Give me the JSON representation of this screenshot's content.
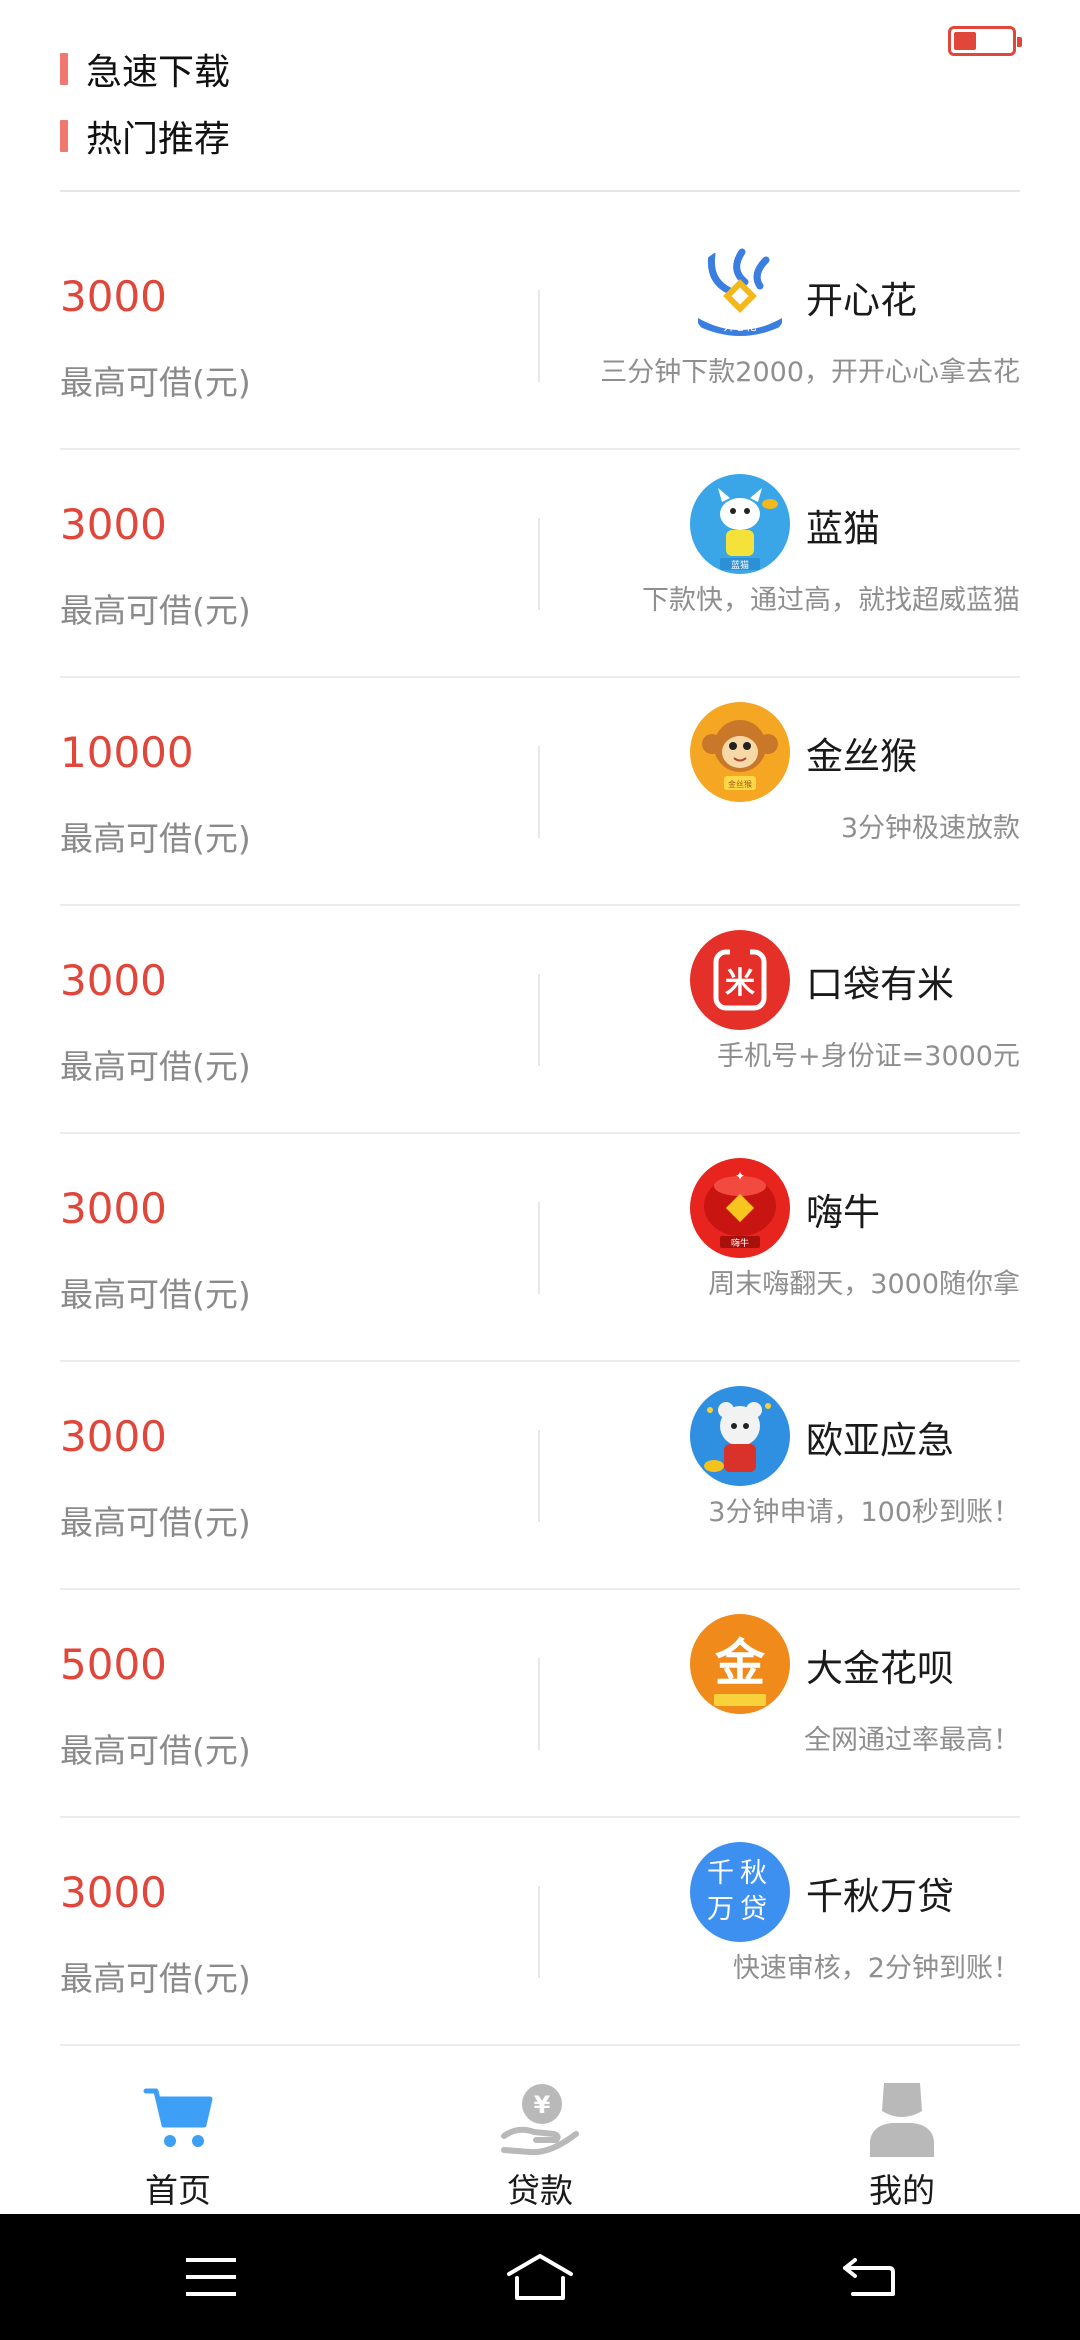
{
  "sections": {
    "download_title": "急速下载",
    "hot_title": "热门推荐"
  },
  "products": [
    {
      "amount": "3000",
      "amount_label": "最高可借(元)",
      "name": "开心花",
      "desc": "三分钟下款2000，开开心心拿去花",
      "icon": "kaixinhua-logo-icon",
      "logo_text": "开心花"
    },
    {
      "amount": "3000",
      "amount_label": "最高可借(元)",
      "name": "蓝猫",
      "desc": "下款快，通过高，就找超威蓝猫",
      "icon": "lanmao-logo-icon",
      "logo_text": "蓝猫"
    },
    {
      "amount": "10000",
      "amount_label": "最高可借(元)",
      "name": "金丝猴",
      "desc": "3分钟极速放款",
      "icon": "jinsihou-logo-icon",
      "logo_text": "金丝猴"
    },
    {
      "amount": "3000",
      "amount_label": "最高可借(元)",
      "name": "口袋有米",
      "desc": "手机号+身份证=3000元",
      "icon": "koudaiyoumi-logo-icon",
      "logo_text": "米"
    },
    {
      "amount": "3000",
      "amount_label": "最高可借(元)",
      "name": "嗨牛",
      "desc": "周末嗨翻天，3000随你拿",
      "icon": "hainiu-logo-icon",
      "logo_text": "嗨牛"
    },
    {
      "amount": "3000",
      "amount_label": "最高可借(元)",
      "name": "欧亚应急",
      "desc": "3分钟申请，100秒到账！",
      "icon": "ouyayingji-logo-icon",
      "logo_text": ""
    },
    {
      "amount": "5000",
      "amount_label": "最高可借(元)",
      "name": "大金花呗",
      "desc": "全网通过率最高！",
      "icon": "dajinhuabei-logo-icon",
      "logo_text": "金"
    },
    {
      "amount": "3000",
      "amount_label": "最高可借(元)",
      "name": "千秋万贷",
      "desc": "快速审核，2分钟到账！",
      "icon": "qianqiuwandai-logo-icon",
      "logo_text": "千秋万贷"
    }
  ],
  "tabbar": {
    "home": "首页",
    "loan": "贷款",
    "mine": "我的"
  },
  "colors": {
    "accent": "#e0463a",
    "tab_home_active": "#3d9ff5",
    "tab_inactive": "#b9b9b9"
  }
}
